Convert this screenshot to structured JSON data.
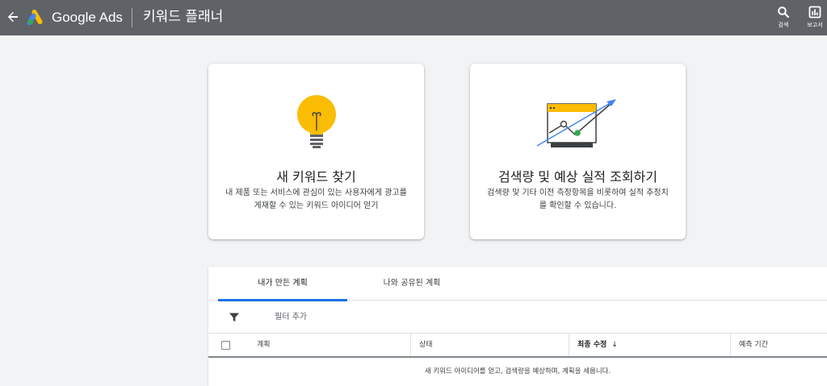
{
  "header": {
    "brand": "Google Ads",
    "page_title": "키워드 플래너",
    "search_label": "검색",
    "reports_label": "보고서"
  },
  "cards": [
    {
      "title": "새 키워드 찾기",
      "description": "내 제품 또는 서비스에 관심이 있는 사용자에게 광고를 게재할 수 있는 키워드 아이디어 얻기",
      "icon": "lightbulb-icon"
    },
    {
      "title": "검색량 및 예상 실적 조회하기",
      "description": "검색량 및 기타 이전 측정항목을 비롯하여 실적 추정치를 확인할 수 있습니다.",
      "icon": "forecast-chart-icon"
    }
  ],
  "plans": {
    "tabs": [
      "내가 만든 계획",
      "나와 공유된 계획"
    ],
    "filter_label": "필터 추가",
    "columns": [
      "계획",
      "상태",
      "최종 수정",
      "예측 기간"
    ],
    "sort_indicator": "↓",
    "empty_message": "새 키워드 아이디어를 얻고, 검색량을 예상하며, 계획을 세웁니다."
  },
  "colors": {
    "header_bg": "#5f6368",
    "page_bg": "#f1f3f4",
    "accent": "#1a73e8",
    "bulb_yellow": "#fbbc04",
    "chart_green": "#34a853",
    "chart_blue": "#4285f4"
  }
}
